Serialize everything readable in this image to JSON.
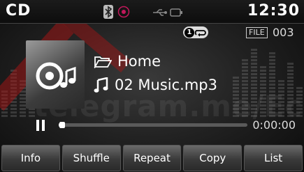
{
  "status_bar": {
    "source_title": "CD",
    "time": "12:30",
    "icons": [
      "bluetooth-icon",
      "radio-icon",
      "usb-icon"
    ]
  },
  "info": {
    "repeat_count": "1",
    "file_label": "FILE",
    "file_number": "003"
  },
  "track": {
    "folder": "Home",
    "song": "02 Music.mp3"
  },
  "playback": {
    "elapsed": "0:00:00",
    "progress_fraction": 0.01
  },
  "watermark": "telegram.me/Ecu",
  "buttons": {
    "info": "Info",
    "shuffle": "Shuffle",
    "repeat": "Repeat",
    "copy": "Copy",
    "list": "List"
  },
  "colors": {
    "background": "#1a1a1a",
    "text": "#ffffff"
  }
}
